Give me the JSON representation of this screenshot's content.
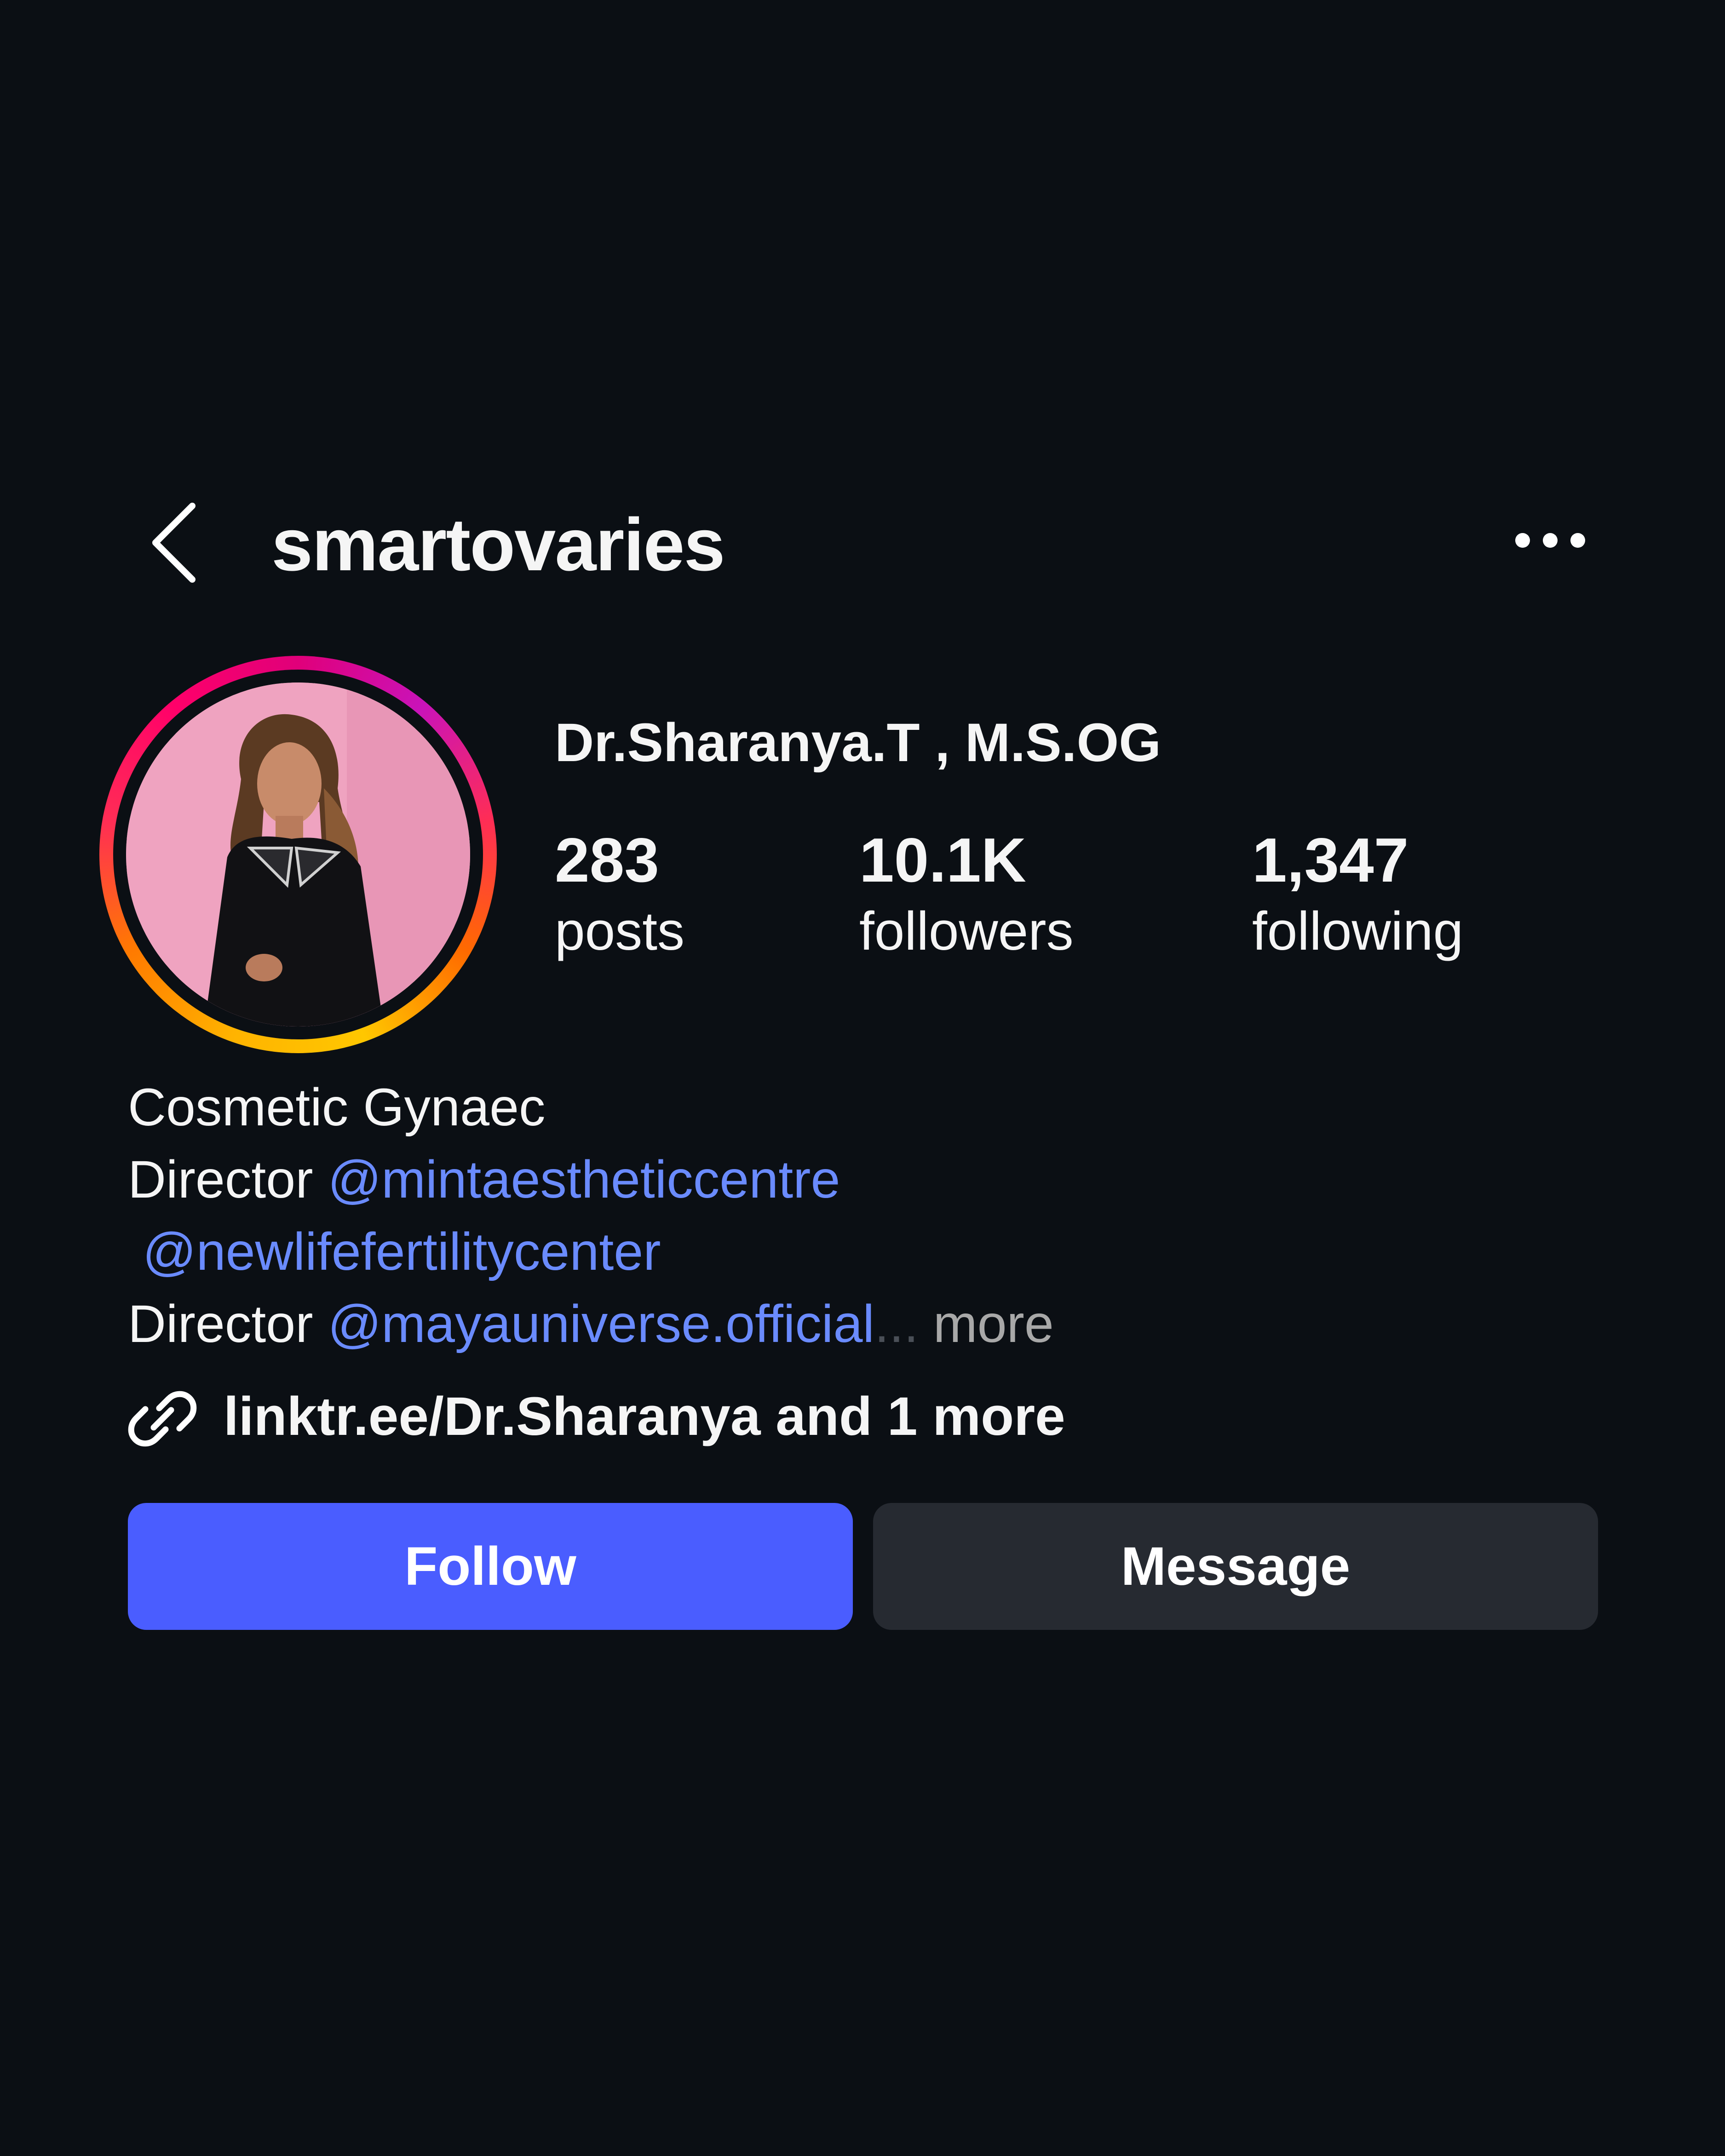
{
  "header": {
    "username": "smartovaries",
    "back_icon": "chevron-left-icon",
    "more_icon": "ellipsis-horizontal-icon"
  },
  "profile": {
    "display_name": "Dr.Sharanya.T , M.S.OG",
    "avatar_ring_colors": [
      "#ffb300",
      "#ff0069",
      "#c913b9"
    ],
    "stats": {
      "posts": {
        "value": "283",
        "label": "posts"
      },
      "followers": {
        "value": "10.1K",
        "label": "followers"
      },
      "following": {
        "value": "1,347",
        "label": "following"
      }
    }
  },
  "bio": {
    "line1": "Cosmetic Gynaec",
    "line2_prefix": "Director ",
    "line2_mention": "@mintaestheticcentre",
    "line3_mention": "@newlifefertilitycenter",
    "line4_prefix": "Director ",
    "line4_mention": "@mayauniverse.official",
    "ellipsis": "...",
    "more": " more",
    "mention_color": "#6a8bff"
  },
  "link": {
    "icon": "link-icon",
    "text": "linktr.ee/Dr.Sharanya and 1 more"
  },
  "actions": {
    "follow_label": "Follow",
    "message_label": "Message",
    "follow_color": "#4a5dff",
    "message_color": "#262a31"
  }
}
